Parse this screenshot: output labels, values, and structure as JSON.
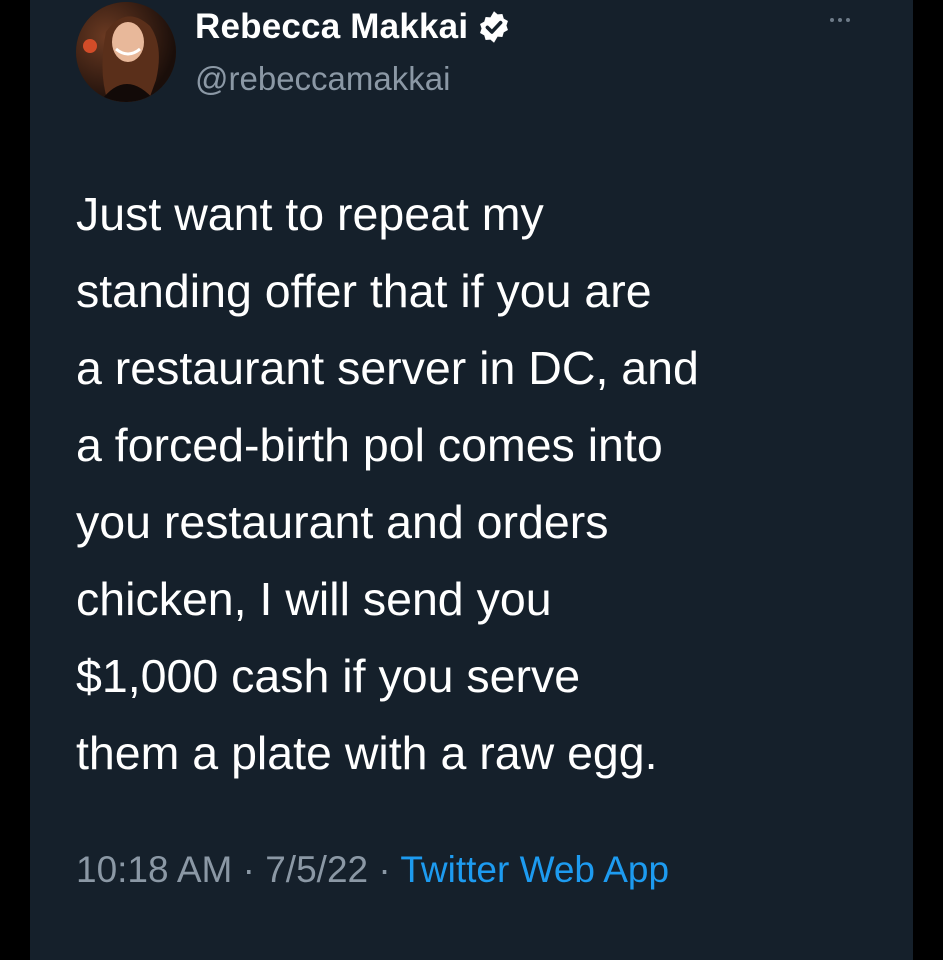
{
  "tweet": {
    "author": {
      "display_name": "Rebecca Makkai",
      "handle": "@rebeccamakkai",
      "verified_icon": "verified-badge-icon",
      "avatar": "profile-photo"
    },
    "more_icon": "more-options-icon",
    "text_lines": [
      "Just want to repeat my",
      "standing offer that if you are",
      "a restaurant server in DC, and",
      "a forced-birth pol comes into",
      "you restaurant and orders",
      "chicken, I will send you",
      "$1,000 cash if you serve",
      "them a plate with a raw egg."
    ],
    "time": "10:18 AM",
    "separator": " · ",
    "date": "7/5/22",
    "source": "Twitter Web App"
  },
  "colors": {
    "background": "#15202b",
    "outer_background": "#000000",
    "text_primary": "#ffffff",
    "text_secondary": "#8b98a5",
    "accent": "#1d9bf0"
  }
}
